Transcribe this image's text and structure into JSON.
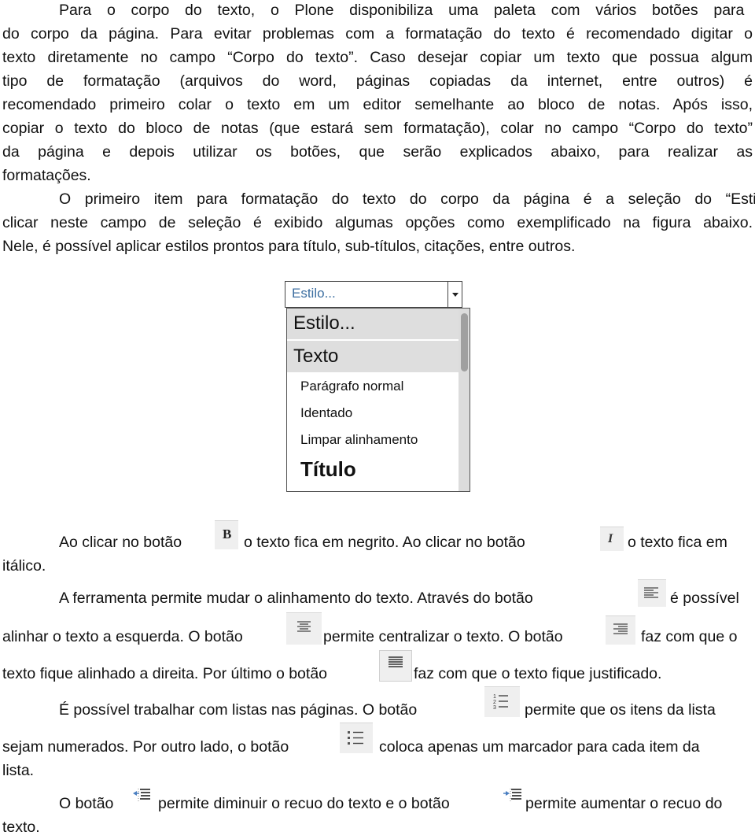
{
  "paragraph1": {
    "lines": [
      "Para o corpo do texto, o Plone disponibiliza uma paleta com vários botões para criação",
      "do corpo da página. Para evitar problemas com a formatação do texto é recomendado digitar o",
      "texto diretamente no campo “Corpo do texto”. Caso desejar copiar um texto que possua algum",
      "tipo de formatação (arquivos do word, páginas copiadas da internet, entre outros) é",
      "recomendado primeiro colar o texto em um editor semelhante ao bloco de notas. Após isso,",
      "copiar o texto do bloco de notas (que estará sem formatação), colar no campo “Corpo do texto”",
      "da página e depois utilizar os botões, que serão explicados abaixo, para realizar as",
      "formatações."
    ]
  },
  "paragraph2": {
    "lines": [
      "O primeiro item para formatação do texto do corpo da página é a seleção do “Estilo”. Ao",
      "clicar neste campo de seleção é exibido algumas opções como exemplificado na figura abaixo.",
      "Nele, é possível aplicar estilos prontos para título, sub-títulos, citações, entre outros."
    ]
  },
  "style_dropdown": {
    "selected": "Estilo...",
    "options": [
      {
        "label": "Estilo...",
        "kind": "header"
      },
      {
        "label": "Texto",
        "kind": "header"
      },
      {
        "label": "Parágrafo normal",
        "kind": "item"
      },
      {
        "label": "Identado",
        "kind": "item"
      },
      {
        "label": "Limpar alinhamento",
        "kind": "item"
      },
      {
        "label": "Título",
        "kind": "heading"
      }
    ]
  },
  "bold_italic": {
    "part1": "Ao clicar no botão",
    "part2": "o texto fica em negrito. Ao clicar no botão",
    "part3": "o texto fica em",
    "part4": "itálico.",
    "bold_icon": "bold-icon",
    "italic_icon": "italic-icon"
  },
  "alignment": {
    "l1a": "A ferramenta permite mudar o alinhamento do texto. Através do botão",
    "l1b": "é possível",
    "l2a": "alinhar o texto a esquerda. O botão",
    "l2b": "permite centralizar o texto. O botão",
    "l2c": "faz com que o",
    "l3a": "texto fique alinhado a direita. Por último o botão",
    "l3b": "faz com que o texto fique justificado."
  },
  "lists": {
    "l1a": "É possível trabalhar com listas nas páginas. O botão",
    "l1b": "permite que os itens da lista",
    "l2a": "sejam numerados. Por outro lado, o botão",
    "l2b": "coloca apenas um marcador para cada item da",
    "l3": "lista."
  },
  "indent": {
    "l1a": "O botão",
    "l1b": "permite diminuir o recuo do texto e o botão",
    "l1c": "permite aumentar o recuo do",
    "l2": "texto."
  },
  "colors": {
    "text": "#111111",
    "dropdown_label": "#3c6ea0",
    "highlight": "#dedede",
    "button_bg": "#efefef",
    "indent_arrow": "#4a7fc1"
  }
}
